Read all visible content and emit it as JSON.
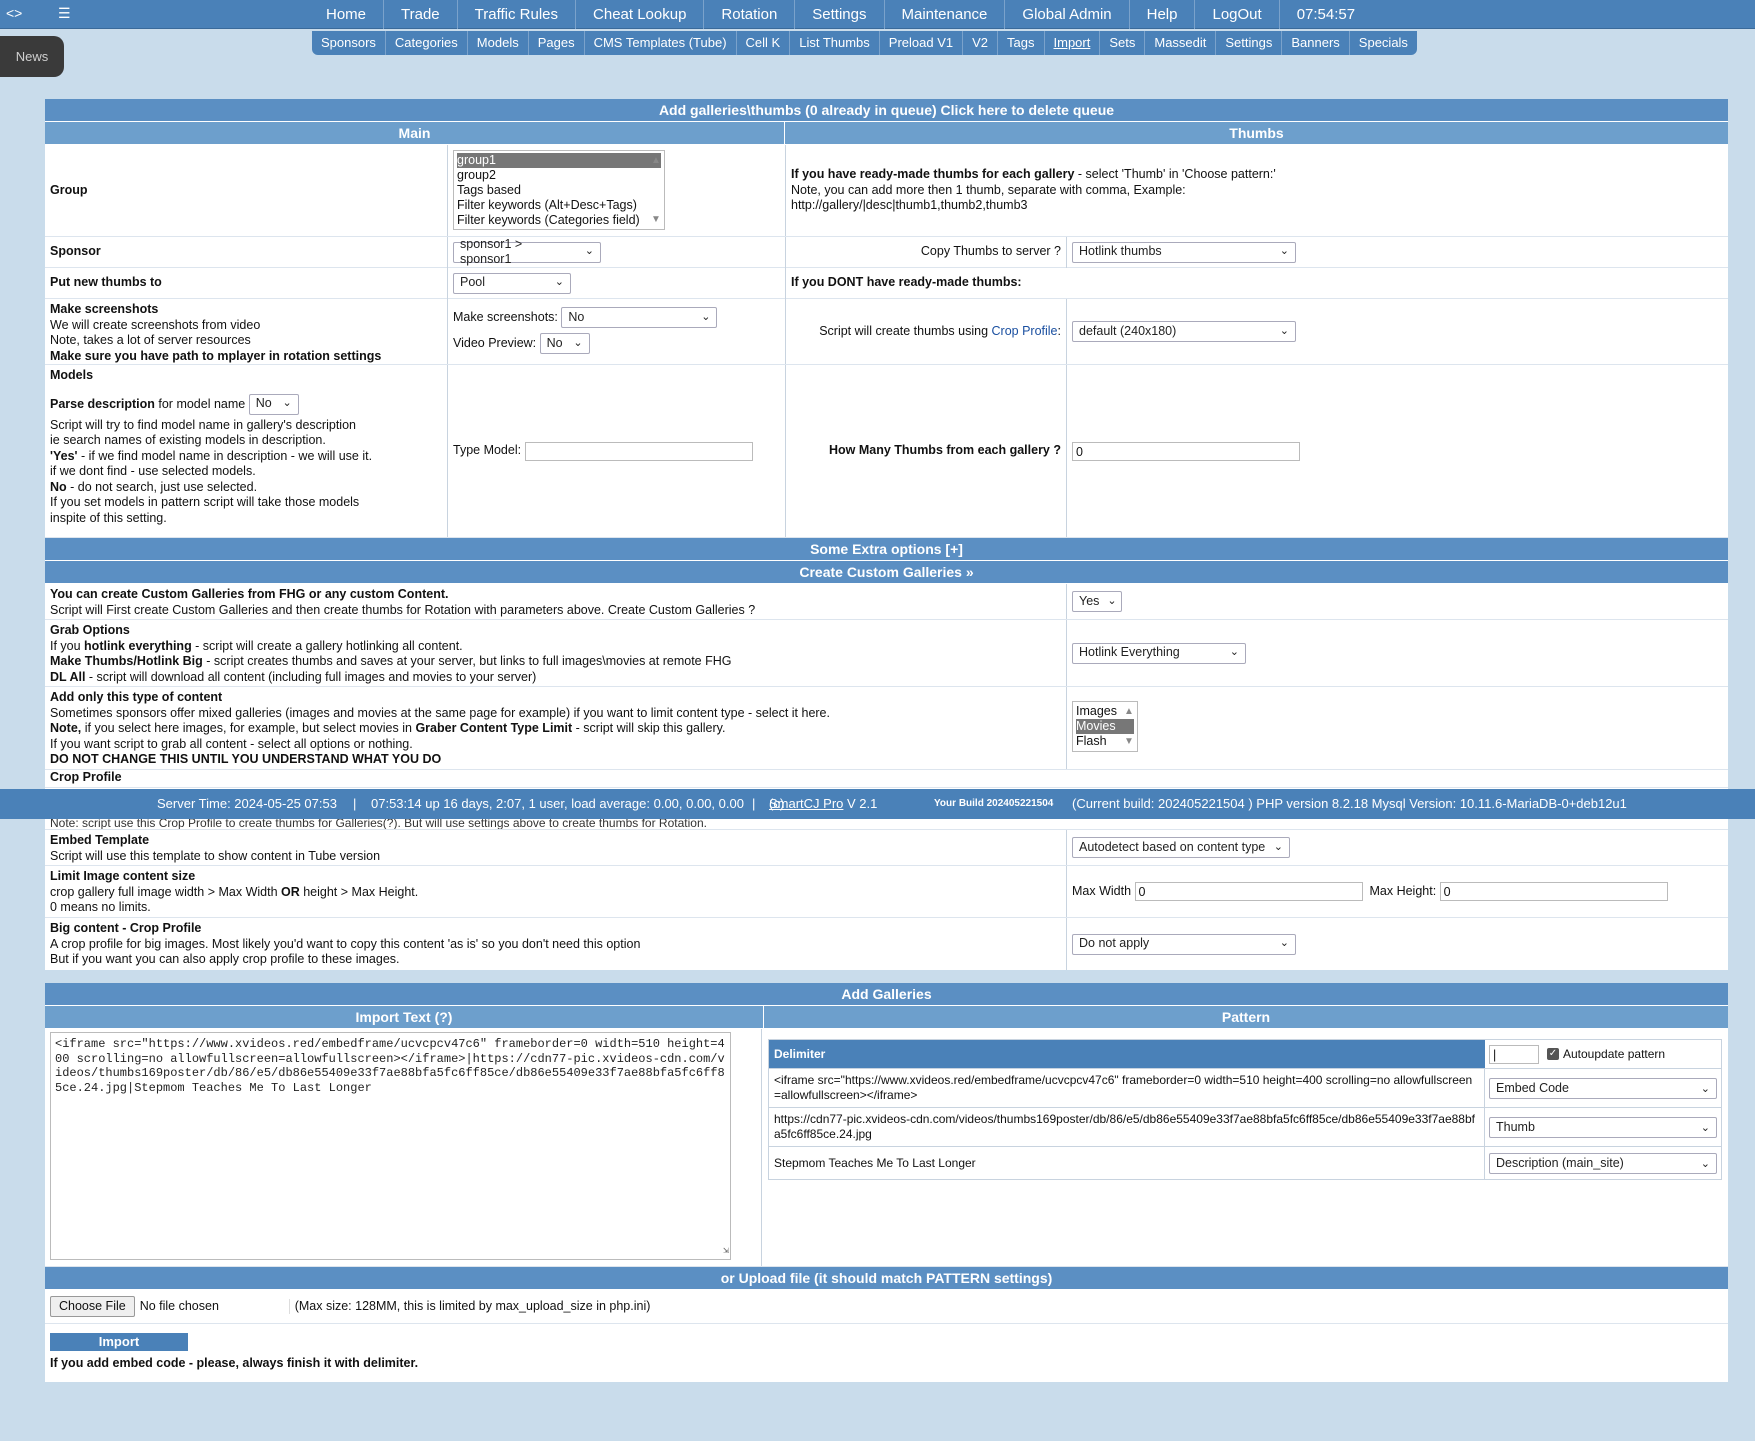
{
  "topnav": {
    "left_icon": "<>",
    "list_icon": "list-icon",
    "items": [
      "Home",
      "Trade",
      "Traffic Rules",
      "Cheat Lookup",
      "Rotation",
      "Settings",
      "Maintenance",
      "Global Admin",
      "Help",
      "LogOut",
      "07:54:57"
    ]
  },
  "subnav": {
    "items": [
      "Sponsors",
      "Categories",
      "Models",
      "Pages",
      "CMS Templates (Tube)",
      "Cell K",
      "List Thumbs",
      "Preload V1",
      "V2",
      "Tags",
      "Import",
      "Sets",
      "Massedit",
      "Settings",
      "Banners",
      "Specials"
    ]
  },
  "news": "News",
  "main": {
    "header": "Add galleries\\thumbs (0 already in queue) Click here to delete queue",
    "col_main": "Main",
    "col_thumbs": "Thumbs",
    "group_label": "Group",
    "group_options": [
      "group1",
      "group2",
      "Tags based",
      "Filter keywords (Alt+Desc+Tags)",
      "Filter keywords (Categories field)"
    ],
    "thumbs_note1_b": "If you have ready-made thumbs for each gallery",
    "thumbs_note1": " - select 'Thumb' in 'Choose pattern:'",
    "thumbs_note2": "Note, you can add more then 1 thumb, separate with comma, Example:",
    "thumbs_note3": "http://gallery/|desc|thumb1,thumb2,thumb3",
    "sponsor_label": "Sponsor",
    "sponsor_value": "sponsor1 > sponsor1",
    "copy_thumbs_label": "Copy Thumbs to server ?",
    "copy_thumbs_value": "Hotlink thumbs",
    "put_new_label": "Put new thumbs to",
    "put_new_value": "Pool",
    "no_ready_label": "If you DONT have ready-made thumbs:",
    "screens_title": "Make screenshots",
    "screens_l1": "We will create screenshots from video",
    "screens_l2": "Note, takes a lot of server resources",
    "screens_l3": "Make sure you have path to mplayer in rotation settings",
    "make_screens_label": "Make screenshots:",
    "make_screens_value": "No",
    "video_preview_label": "Video Preview:",
    "video_preview_value": "No",
    "crop_script_label": "Script will create thumbs using ",
    "crop_profile_link": "Crop Profile",
    "crop_colon": ":",
    "crop_value": "default (240x180)",
    "models_title": "Models",
    "parse_b": "Parse description",
    "parse_rest": " for model name",
    "parse_value": "No",
    "models_l1": "Script will try to find model name in gallery's description",
    "models_l2": "ie search names of existing models in description.",
    "models_l3b": "'Yes'",
    "models_l3": " - if we find model name in description - we will use it.",
    "models_l4": "if we dont find - use selected models.",
    "models_l5b": "No",
    "models_l5": " - do not search, just use selected.",
    "models_l6": "If you set models in pattern script will take those models",
    "models_l7": "inspite of this setting.",
    "type_model_label": "Type Model:",
    "how_many_label": "How Many Thumbs from each gallery ?",
    "how_many_value": "0"
  },
  "extra": {
    "header": "Some Extra options [+]",
    "custom_header": "Create Custom Galleries »",
    "custom_b": "You can create Custom Galleries from FHG or any custom Content.",
    "custom_l": "Script will First create Custom Galleries and then create thumbs for Rotation with parameters above. Create Custom Galleries ?",
    "custom_value": "Yes",
    "grab_title": "Grab Options",
    "grab_l1a": "If you ",
    "grab_l1b": "hotlink everything",
    "grab_l1c": " - script will create a gallery hotlinking all content.",
    "grab_l2b": "Make Thumbs/Hotlink Big",
    "grab_l2c": " - script creates thumbs and saves at your server, but links to full images\\movies at remote FHG",
    "grab_l3b": "DL All",
    "grab_l3c": " - script will download all content (including full images and movies to your server)",
    "grab_value": "Hotlink Everything",
    "type_title": "Add only this type of content",
    "type_l1": "Sometimes sponsors offer mixed galleries (images and movies at the same page for example) if you want to limit content type - select it here.",
    "type_l2b": "Note,",
    "type_l2a": " if you select here images, for example, but select movies in ",
    "type_l2c": "Graber Content Type Limit",
    "type_l2d": " - script will skip this gallery.",
    "type_l3": "If you want script to grab all content - select all options or nothing.",
    "type_l4": "DO NOT CHANGE THIS UNTIL YOU UNDERSTAND WHAT YOU DO",
    "type_options": [
      "Images",
      "Movies",
      "Flash"
    ],
    "crop_partial": "Crop Profile",
    "note_partial": "Note: script use this Crop Profile to create thumbs for Galleries(?). But will use settings above to create thumbs for Rotation.",
    "embed_title": "Embed Template",
    "embed_l": "Script will use this template to show content in Tube version",
    "embed_value": "Autodetect based on content type",
    "limit_title": "Limit Image content size",
    "limit_l1a": "crop gallery full image width > Max Width ",
    "limit_l1b": "OR",
    "limit_l1c": " height > Max Height.",
    "limit_l2": "0 means no limits.",
    "max_width_label": "Max Width",
    "max_width_value": "0",
    "max_height_label": "Max Height:",
    "max_height_value": "0",
    "big_title": "Big content - Crop Profile",
    "big_l1": "A crop profile for big images. Most likely you'd want to copy this content 'as is' so you don't need this option",
    "big_l2": "But if you want you can also apply crop profile to these images.",
    "big_value": "Do not apply"
  },
  "status": {
    "server_time": "Server Time: 2024-05-25 07:53",
    "sep1": "|",
    "uptime": "07:53:14 up 16 days, 2:07, 1 user, load average: 0.00, 0.00, 0.00",
    "sep2": "|",
    "copy": "(c) ",
    "link": "SmartCJ Pro",
    "version": " V 2.1",
    "build": "Your Build 202405221504",
    "current": "(Current build: 202405221504 ) PHP version 8.2.18 Mysql Version: 10.11.6-MariaDB-0+deb12u1"
  },
  "add": {
    "header": "Add Galleries",
    "col_import": "Import Text (?)",
    "col_pattern": "Pattern",
    "import_text": "<iframe src=\"https://www.xvideos.red/embedframe/ucvcpcv47c6\" frameborder=0 width=510 height=400 scrolling=no allowfullscreen=allowfullscreen></iframe>|https://cdn77-pic.xvideos-cdn.com/videos/thumbs169poster/db/86/e5/db86e55409e33f7ae88bfa5fc6ff85ce/db86e55409e33f7ae88bfa5fc6ff85ce.24.jpg|Stepmom Teaches Me To Last Longer",
    "delimiter_label": "Delimiter",
    "delimiter_value": "|",
    "autoupdate_label": "Autoupdate pattern",
    "rows": [
      {
        "text": "<iframe src=\"https://www.xvideos.red/embedframe/ucvcpcv47c6\" frameborder=0 width=510 height=400 scrolling=no allowfullscreen=allowfullscreen></iframe>",
        "value": "Embed Code"
      },
      {
        "text": "https://cdn77-pic.xvideos-cdn.com/videos/thumbs169poster/db/86/e5/db86e55409e33f7ae88bfa5fc6ff85ce/db86e55409e33f7ae88bfa5fc6ff85ce.24.jpg",
        "value": "Thumb"
      },
      {
        "text": "Stepmom Teaches Me To Last Longer",
        "value": "Description (main_site)"
      }
    ],
    "upload_header": "or Upload file (it should match PATTERN settings)",
    "choose_file": "Choose File",
    "no_file": "No file chosen",
    "max_size": "(Max size: 128MM, this is limited by max_upload_size in php.ini)",
    "import_button": "Import",
    "footer_note": "If you add embed code - please, always finish it with delimiter."
  },
  "colors": {
    "nav": "#4a81b8",
    "bar": "#6d9fcc",
    "background": "#c9dceb"
  }
}
